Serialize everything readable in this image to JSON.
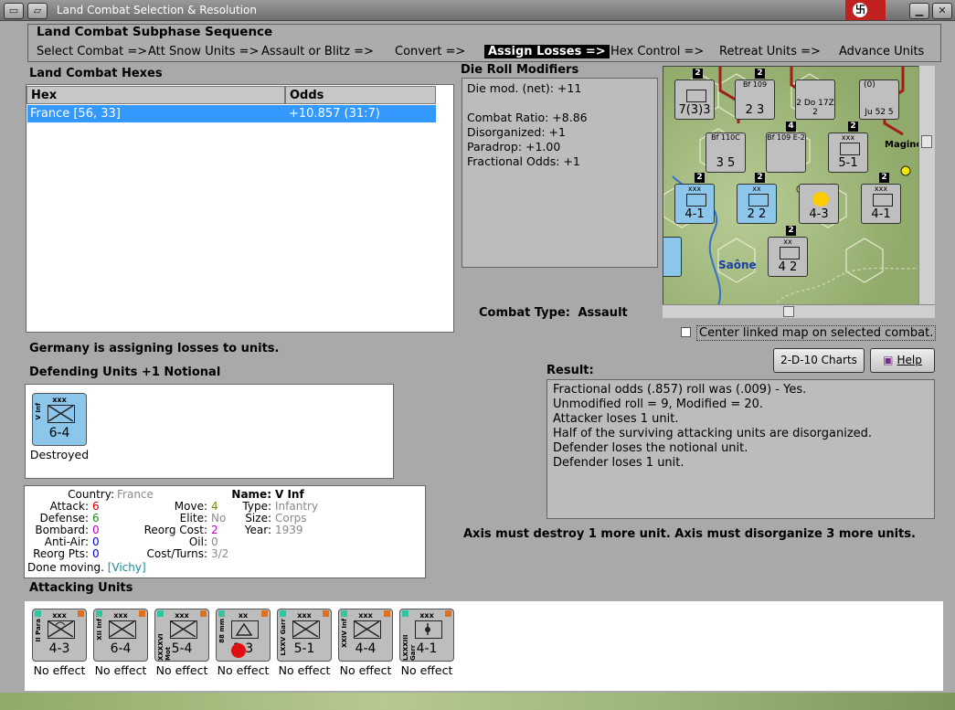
{
  "window": {
    "title": "Land Combat Selection & Resolution"
  },
  "phase": {
    "title": "Land Combat Subphase Sequence",
    "steps": [
      "Select Combat =>",
      "Att Snow Units =>",
      "Assault or Blitz =>",
      "Convert =>",
      "Assign Losses =>",
      "Hex Control =>",
      "Retreat Units =>",
      "Advance Units"
    ],
    "active_step": "Assign Losses =>"
  },
  "hexes": {
    "label": "Land Combat Hexes",
    "columns": [
      "Hex",
      "Odds"
    ],
    "rows": [
      {
        "hex": "France [56, 33]",
        "odds": "+10.857 (31:7)"
      }
    ]
  },
  "die_roll": {
    "label": "Die Roll Modifiers",
    "lines": [
      "Die mod. (net): +11",
      "",
      "Combat Ratio: +8.86",
      "Disorganized: +1",
      "Paradrop: +1.00",
      "Fractional Odds: +1"
    ]
  },
  "combat_type": {
    "label": "Combat Type:",
    "value": "Assault"
  },
  "map": {
    "river_label": "Saône",
    "place_label": "Maginot",
    "counters": [
      {
        "top": "xxxxx",
        "value": "7(3)3"
      },
      {
        "top": "Bf 109",
        "value": "2  3"
      },
      {
        "top": "",
        "value": "2 Do 17Z 2"
      },
      {
        "top": "(0)",
        "value": "Ju 52 5"
      },
      {
        "top": "Bf 110C",
        "value": "3  5"
      },
      {
        "top": "Bf 109 E-2",
        "value": ""
      },
      {
        "top": "xxx",
        "value": "5-1"
      },
      {
        "top": "xxx",
        "value": "4-1"
      },
      {
        "top": "xx",
        "value": "2 2"
      },
      {
        "top": "",
        "value": "4-3"
      },
      {
        "top": "xxx",
        "value": "4-1"
      },
      {
        "top": "xx",
        "value": "4 2"
      }
    ],
    "stack_badges": [
      "2",
      "2",
      "4",
      "2",
      "2",
      "2",
      "2",
      "2"
    ]
  },
  "center_checkbox": {
    "label": "Center linked map on selected combat."
  },
  "buttons": {
    "charts": "2-D-10 Charts",
    "help": "Help"
  },
  "status": "Germany is assigning losses to units.",
  "defending": {
    "label": "Defending Units +1 Notional",
    "units": [
      {
        "size": "xxx",
        "name": "V Inf",
        "strength": "6-4",
        "result": "Destroyed"
      }
    ]
  },
  "result": {
    "label": "Result:",
    "lines": [
      "Fractional odds (.857) roll was (.009)  - Yes.",
      "Unmodified roll = 9, Modified = 20.",
      "Attacker loses 1 unit.",
      "Half of the surviving attacking units are disorganized.",
      "Defender loses the notional unit.",
      "Defender loses 1 unit."
    ]
  },
  "axis_message": "Axis must destroy 1 more unit. Axis must disorganize 3 more units.",
  "unit_info": {
    "country_label": "Country:",
    "country": "France",
    "attack_label": "Attack:",
    "attack": "6",
    "defense_label": "Defense:",
    "defense": "6",
    "bombard_label": "Bombard:",
    "bombard": "0",
    "antiair_label": "Anti-Air:",
    "antiair": "0",
    "reorgpts_label": "Reorg Pts:",
    "reorgpts": "0",
    "done_moving": "Done moving.",
    "vichy": "[Vichy]",
    "move_label": "Move:",
    "move": "4",
    "elite_label": "Elite:",
    "elite": "No",
    "reorgcost_label": "Reorg Cost:",
    "reorgcost": "2",
    "oil_label": "Oil:",
    "oil": "0",
    "costturns_label": "Cost/Turns:",
    "costturns": "3/2",
    "name_label": "Name:",
    "name": "V Inf",
    "type_label": "Type:",
    "type": "Infantry",
    "size_label": "Size:",
    "size": "Corps",
    "year_label": "Year:",
    "year": "1939"
  },
  "attacking": {
    "label": "Attacking Units",
    "units": [
      {
        "size": "xxx",
        "name": "II Para",
        "strength": "4-3",
        "result": "No effect"
      },
      {
        "size": "xxx",
        "name": "XII Inf",
        "strength": "6-4",
        "result": "No effect"
      },
      {
        "size": "xxx",
        "name": "XXXXVI Mot",
        "strength": "5-4",
        "result": "No effect"
      },
      {
        "size": "xx",
        "name": "88 mm",
        "strength": "3 3",
        "result": "No effect"
      },
      {
        "size": "xxx",
        "name": "LXXV Garr",
        "strength": "5-1",
        "result": "No effect"
      },
      {
        "size": "xxx",
        "name": "XXIV Inf",
        "strength": "4-4",
        "result": "No effect"
      },
      {
        "size": "xxx",
        "name": "LXXXIII Garr",
        "strength": "4-1",
        "result": "No effect"
      }
    ]
  }
}
